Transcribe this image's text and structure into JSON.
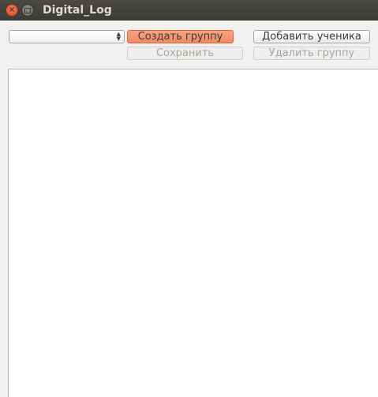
{
  "window": {
    "title": "Digital_Log",
    "close_glyph": "×"
  },
  "toolbar": {
    "group_select": {
      "value": ""
    },
    "create_group_label": "Создать группу",
    "add_student_label": "Добавить ученика",
    "save_label": "Сохранить",
    "delete_group_label": "Удалить группу"
  },
  "icons": {
    "close": "close-icon",
    "maximize": "maximize-icon",
    "combo_arrows": "chevron-updown-icon"
  },
  "colors": {
    "titlebar": "#3c3b37",
    "accent_button": "#f28a63",
    "close_button": "#d9481f",
    "disabled_text": "#a8a6a2",
    "content_bg": "#ffffff"
  }
}
